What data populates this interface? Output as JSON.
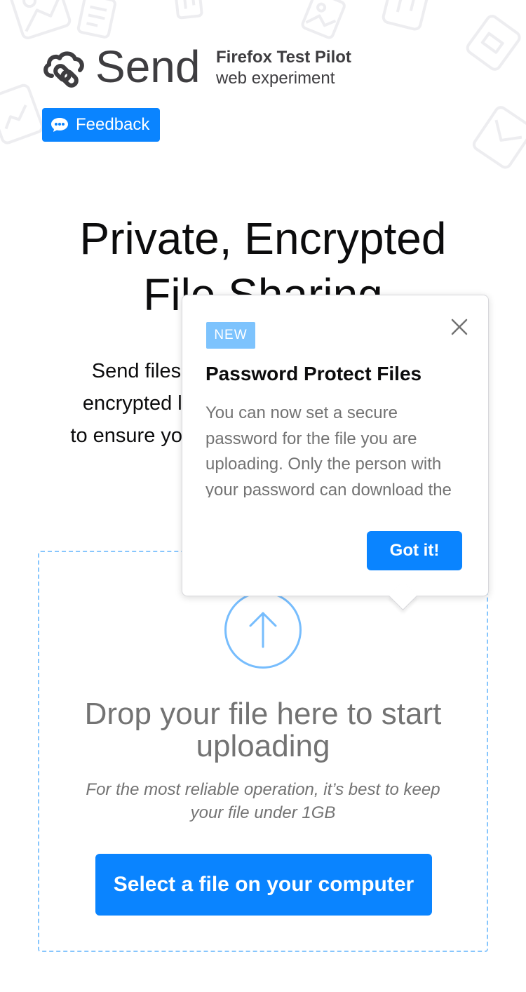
{
  "brand": {
    "name": "Send",
    "subtitle_bold": "Firefox Test Pilot",
    "subtitle": "web experiment",
    "logo_icon": "send-cloud-link-icon"
  },
  "feedback": {
    "label": "Feedback",
    "icon": "chat-bubble-icon"
  },
  "hero": {
    "title_line1": "Private, Encrypted",
    "title_line2": "File Sharing",
    "desc_line1": "Send files through a safe, private, and",
    "desc_line2": "encrypted link that automatically expires",
    "desc_line3": "to ensure your stuff does not remain online"
  },
  "dropzone": {
    "icon": "upload-arrow-icon",
    "title": "Drop your file here to start uploading",
    "note": "For the most reliable operation, it’s best to keep your file under 1GB",
    "select_button": "Select a file on your computer"
  },
  "popover": {
    "badge": "NEW",
    "title": "Password Protect Files",
    "body": "You can now set a secure password for the file you are uploading. Only the person with your password can download the file.",
    "cta": "Got it!",
    "close_icon": "close-icon"
  },
  "colors": {
    "accent": "#0a84ff",
    "badge": "#7dc3fd",
    "dropzone_border": "#87c6fd",
    "muted_text": "#737373",
    "heading": "#0c0c0d"
  }
}
